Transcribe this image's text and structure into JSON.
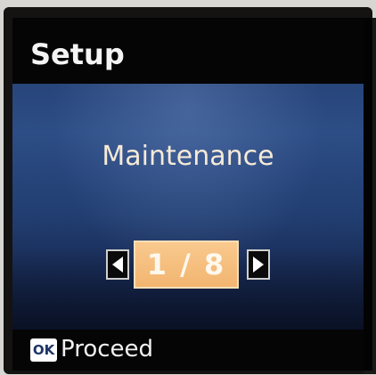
{
  "header": {
    "title": "Setup"
  },
  "menu": {
    "current_item_label": "Maintenance",
    "page_indicator": "1 / 8",
    "current_page": 1,
    "total_pages": 8
  },
  "navigation": {
    "prev_icon": "arrow-left-icon",
    "next_icon": "arrow-right-icon"
  },
  "footer": {
    "ok_badge_label": "OK",
    "action_label": "Proceed"
  },
  "colors": {
    "screen_bg": "#030303",
    "content_bg_top": "#2d4d86",
    "content_bg_bottom": "#0f1a35",
    "indicator_bg": "#f2b570",
    "item_label_color": "#f6ead7"
  }
}
